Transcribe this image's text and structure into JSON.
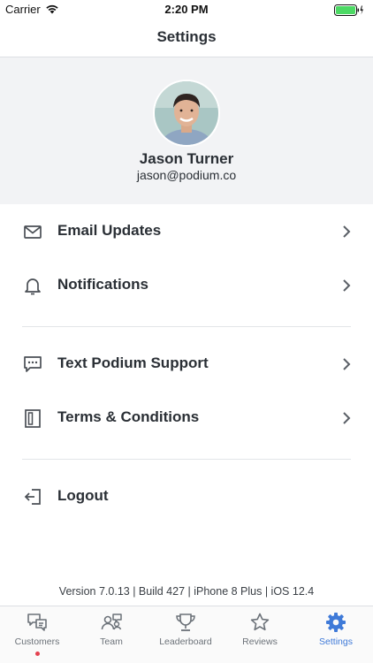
{
  "status_bar": {
    "carrier": "Carrier",
    "time": "2:20 PM",
    "battery_color": "#4cd964"
  },
  "nav": {
    "title": "Settings"
  },
  "profile": {
    "name": "Jason Turner",
    "email": "jason@podium.co"
  },
  "menu": [
    {
      "label": "Email Updates",
      "icon": "mail-icon"
    },
    {
      "label": "Notifications",
      "icon": "bell-icon"
    },
    {
      "label": "Text Podium Support",
      "icon": "chat-bubble-icon"
    },
    {
      "label": "Terms & Conditions",
      "icon": "document-icon"
    },
    {
      "label": "Logout",
      "icon": "logout-icon"
    }
  ],
  "version_info": "Version 7.0.13 | Build 427 | iPhone 8 Plus | iOS 12.4",
  "tab_bar": {
    "active": "Settings",
    "tabs": [
      {
        "label": "Customers",
        "icon": "customers-chat-icon",
        "has_notification": true
      },
      {
        "label": "Team",
        "icon": "team-icon",
        "has_notification": false
      },
      {
        "label": "Leaderboard",
        "icon": "trophy-icon",
        "has_notification": false
      },
      {
        "label": "Reviews",
        "icon": "star-icon",
        "has_notification": false
      },
      {
        "label": "Settings",
        "icon": "gear-icon",
        "has_notification": false
      }
    ]
  },
  "colors": {
    "accent": "#3f7ad8",
    "text": "#2a2f35",
    "profile_bg": "#f2f3f5",
    "notification_dot": "#e4414f"
  }
}
